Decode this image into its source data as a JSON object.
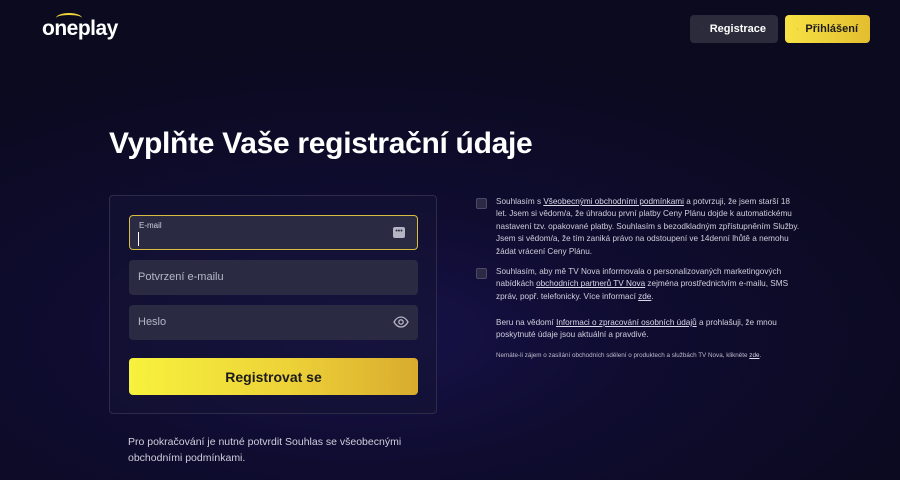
{
  "header": {
    "logo_text": "oneplay",
    "register_label": "Registrace",
    "login_label": "Přihlášení"
  },
  "page": {
    "title": "Vyplňte Vaše registrační údaje"
  },
  "form": {
    "email_label": "E-mail",
    "email_value": "",
    "confirm_placeholder": "Potvrzení e-mailu",
    "password_placeholder": "Heslo",
    "submit_label": "Registrovat se"
  },
  "note": "Pro pokračování je nutné potvrdit Souhlas se všeobecnými obchodními podmínkami.",
  "consents": {
    "terms": {
      "pre": "Souhlasím s ",
      "link": "Všeobecnými obchodními podmínkami",
      "post": " a potvrzuji, že jsem starší 18 let. Jsem si vědom/a, že úhradou první platby Ceny Plánu dojde k automatickému nastavení tzv. opakované platby. Souhlasím s bezodkladným zpřístupněním Služby. Jsem si vědom/a, že tím zaniká právo na odstoupení ve 14denní lhůtě a nemohu žádat vrácení Ceny Plánu."
    },
    "marketing": {
      "pre": "Souhlasím, aby mě TV Nova informovala o personalizovaných marketingových nabídkách ",
      "link": "obchodních partnerů TV Nova",
      "mid": " zejména prostřednictvím e-mailu, SMS zpráv, popř. telefonicky. Více informací ",
      "link2": "zde",
      "post": "."
    },
    "privacy": {
      "pre": "Beru na vědomí ",
      "link": "Informaci o zpracování osobních údajů",
      "post": " a prohlašuji, že mnou poskytnuté údaje jsou aktuální a pravdivé."
    },
    "optout": {
      "pre": "Nemáte-li zájem o zasílání obchodních sdělení o produktech a službách TV Nova, klikněte ",
      "link": "zde",
      "post": "."
    }
  },
  "colors": {
    "accent": "#f2d43a",
    "background": "#0f0c30"
  }
}
